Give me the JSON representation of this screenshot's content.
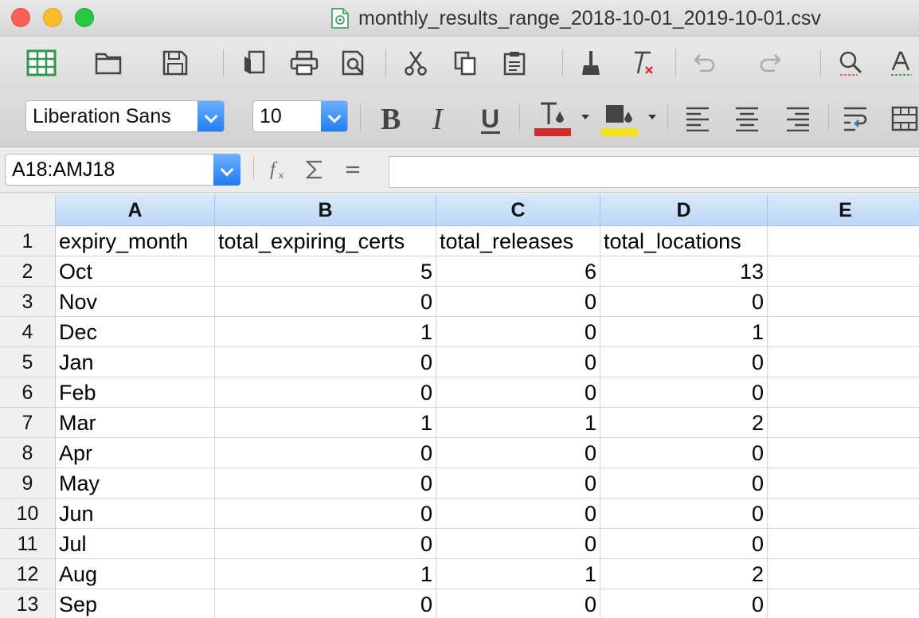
{
  "window": {
    "title": "monthly_results_range_2018-10-01_2019-10-01.csv"
  },
  "formatting": {
    "font_name": "Liberation Sans",
    "font_size": "10",
    "font_color": "#d22a2a",
    "highlight_color": "#f2e21a"
  },
  "formula_bar": {
    "name_box": "A18:AMJ18",
    "formula": ""
  },
  "sheet": {
    "columns": [
      "A",
      "B",
      "C",
      "D",
      "E"
    ],
    "rows": [
      {
        "n": "1",
        "cells": [
          "expiry_month",
          "total_expiring_certs",
          "total_releases",
          "total_locations",
          ""
        ]
      },
      {
        "n": "2",
        "cells": [
          "Oct",
          "5",
          "6",
          "13",
          ""
        ]
      },
      {
        "n": "3",
        "cells": [
          "Nov",
          "0",
          "0",
          "0",
          ""
        ]
      },
      {
        "n": "4",
        "cells": [
          "Dec",
          "1",
          "0",
          "1",
          ""
        ]
      },
      {
        "n": "5",
        "cells": [
          "Jan",
          "0",
          "0",
          "0",
          ""
        ]
      },
      {
        "n": "6",
        "cells": [
          "Feb",
          "0",
          "0",
          "0",
          ""
        ]
      },
      {
        "n": "7",
        "cells": [
          "Mar",
          "1",
          "1",
          "2",
          ""
        ]
      },
      {
        "n": "8",
        "cells": [
          "Apr",
          "0",
          "0",
          "0",
          ""
        ]
      },
      {
        "n": "9",
        "cells": [
          "May",
          "0",
          "0",
          "0",
          ""
        ]
      },
      {
        "n": "10",
        "cells": [
          "Jun",
          "0",
          "0",
          "0",
          ""
        ]
      },
      {
        "n": "11",
        "cells": [
          "Jul",
          "0",
          "0",
          "0",
          ""
        ]
      },
      {
        "n": "12",
        "cells": [
          "Aug",
          "1",
          "1",
          "2",
          ""
        ]
      },
      {
        "n": "13",
        "cells": [
          "Sep",
          "0",
          "0",
          "0",
          ""
        ]
      }
    ]
  }
}
